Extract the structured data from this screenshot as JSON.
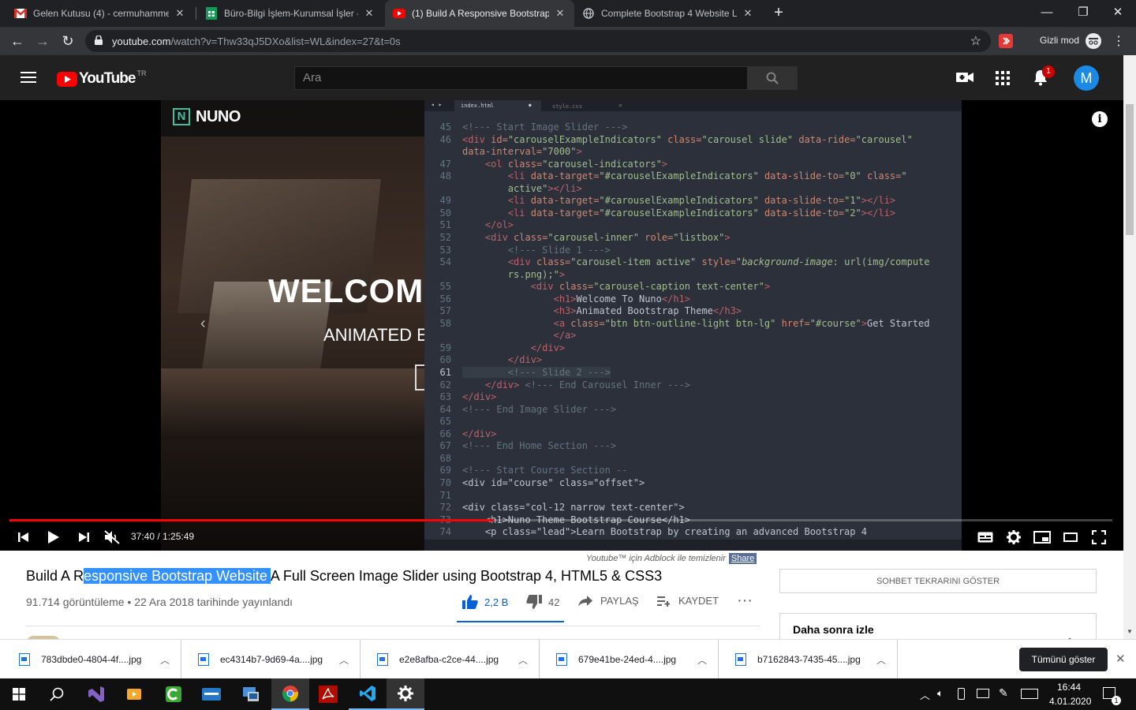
{
  "browser": {
    "tabs": [
      {
        "title": "Gelen Kutusu (4) - cermuhammed",
        "icon": "gmail-icon"
      },
      {
        "title": "Büro-Bilgi İşlem-Kurumsal İşler - ",
        "icon": "sheets-icon"
      },
      {
        "title": "(1) Build A Responsive Bootstrap",
        "icon": "youtube-icon",
        "active": true
      },
      {
        "title": "Complete Bootstrap 4 Website La",
        "icon": "globe-icon"
      }
    ],
    "url_host": "youtube.com",
    "url_rest": "/watch?v=Thw33qJ5DXo&list=WL&index=27&t=0s",
    "incognito_label": "Gizli mod"
  },
  "youtube": {
    "logo_text": "YouTube",
    "region": "TR",
    "search_placeholder": "Ara",
    "notif_count": "1",
    "avatar_letter": "M"
  },
  "video": {
    "brand": "NUNO",
    "overlay_welcome": "WELCOM",
    "overlay_sub": "ANIMATED E",
    "time": "37:40 / 1:25:49",
    "progress": 0.439,
    "editor_tabs": [
      "index.html",
      "style.css"
    ],
    "code_lines": [
      {
        "n": "45",
        "html": "<span class='kc'>&lt;!--- Start Image Slider ---&gt;</span>"
      },
      {
        "n": "46",
        "html": "<span class='kt'>&lt;div</span> <span class='ka'>id=</span><span class='ks'>\"carouselExampleIndicators\"</span> <span class='ka'>class=</span><span class='ks'>\"carousel slide\"</span> <span class='ka'>data-ride=</span><span class='ks'>\"carousel\"</span>"
      },
      {
        "n": "",
        "html": "<span class='ka'>data-interval=</span><span class='ks'>\"7000\"</span><span class='kt'>&gt;</span>"
      },
      {
        "n": "47",
        "html": "    <span class='kt'>&lt;ol</span> <span class='ka'>class=</span><span class='ks'>\"carousel-indicators\"</span><span class='kt'>&gt;</span>"
      },
      {
        "n": "48",
        "html": "        <span class='kt'>&lt;li</span> <span class='ka'>data-target=</span><span class='ks'>\"#carouselExampleIndicators\"</span> <span class='ka'>data-slide-to=</span><span class='ks'>\"0\"</span> <span class='ka'>class=</span><span class='ks'>\"</span>"
      },
      {
        "n": "",
        "html": "        <span class='ks'>active\"</span><span class='kt'>&gt;&lt;/li&gt;</span>"
      },
      {
        "n": "49",
        "html": "        <span class='kt'>&lt;li</span> <span class='ka'>data-target=</span><span class='ks'>\"#carouselExampleIndicators\"</span> <span class='ka'>data-slide-to=</span><span class='ks'>\"1\"</span><span class='kt'>&gt;&lt;/li&gt;</span>"
      },
      {
        "n": "50",
        "html": "        <span class='kt'>&lt;li</span> <span class='ka'>data-target=</span><span class='ks'>\"#carouselExampleIndicators\"</span> <span class='ka'>data-slide-to=</span><span class='ks'>\"2\"</span><span class='kt'>&gt;&lt;/li&gt;</span>"
      },
      {
        "n": "51",
        "html": "    <span class='kt'>&lt;/ol&gt;</span>"
      },
      {
        "n": "52",
        "html": "    <span class='kt'>&lt;div</span> <span class='ka'>class=</span><span class='ks'>\"carousel-inner\"</span> <span class='ka'>role=</span><span class='ks'>\"listbox\"</span><span class='kt'>&gt;</span>"
      },
      {
        "n": "53",
        "html": "        <span class='kc'>&lt;!--- Slide 1 ---&gt;</span>"
      },
      {
        "n": "54",
        "html": "        <span class='kt'>&lt;div</span> <span class='ka'>class=</span><span class='ks'>\"carousel-item active\"</span> <span class='ka'>style=</span><span class='ks'>\"<i>background-image</i>: url(img/compute</span>"
      },
      {
        "n": "",
        "html": "        <span class='ks'>rs.png);\"</span><span class='kt'>&gt;</span>"
      },
      {
        "n": "55",
        "html": "            <span class='kt'>&lt;div</span> <span class='ka'>class=</span><span class='ks'>\"carousel-caption text-center\"</span><span class='kt'>&gt;</span>"
      },
      {
        "n": "56",
        "html": "                <span class='kt'>&lt;h1&gt;</span>Welcome To Nuno<span class='kt'>&lt;/h1&gt;</span>"
      },
      {
        "n": "57",
        "html": "                <span class='kt'>&lt;h3&gt;</span>Animated Bootstrap Theme<span class='kt'>&lt;/h3&gt;</span>"
      },
      {
        "n": "58",
        "html": "                <span class='kt'>&lt;a</span> <span class='ka'>class=</span><span class='ks'>\"btn btn-outline-light btn-lg\"</span> <span class='ka'>href=</span><span class='ks'>\"#course\"</span><span class='kt'>&gt;</span>Get Started"
      },
      {
        "n": "",
        "html": "                <span class='kt'>&lt;/a&gt;</span>"
      },
      {
        "n": "59",
        "html": "            <span class='kt'>&lt;/div&gt;</span>"
      },
      {
        "n": "60",
        "html": "        <span class='kt'>&lt;/div&gt;</span>"
      },
      {
        "n": "61",
        "html": "        <span class='kc'>&lt;!--- Slide 2 ---&gt;</span>"
      },
      {
        "n": "62",
        "html": "    <span class='kt'>&lt;/div&gt;</span> <span class='kc'>&lt;!--- End Carousel Inner ---&gt;</span>"
      },
      {
        "n": "63",
        "html": "<span class='kt'>&lt;/div&gt;</span>"
      },
      {
        "n": "64",
        "html": "<span class='kc'>&lt;!--- End Image Slider ---&gt;</span>"
      },
      {
        "n": "65",
        "html": ""
      },
      {
        "n": "66",
        "html": "<span class='kt'>&lt;/div&gt;</span>"
      },
      {
        "n": "67",
        "html": "<span class='kc'>&lt;!--- End Home Section ---&gt;</span>"
      },
      {
        "n": "68",
        "html": ""
      },
      {
        "n": "69",
        "html": "<span class='kc'>&lt;!--- Start Course Section --</span>"
      },
      {
        "n": "70",
        "html": "<span class='kw'>&lt;div id=\"course\" class=\"offset\"&gt;</span>"
      },
      {
        "n": "71",
        "html": ""
      },
      {
        "n": "72",
        "html": "<span class='kw'>&lt;div class=\"col-12 narrow text-center\"&gt;</span>"
      },
      {
        "n": "73",
        "html": "    <span class='kw'>&lt;h1&gt;Nuno Theme Bootstrap Course&lt;/h1&gt;</span>"
      },
      {
        "n": "74",
        "html": "    <span class='kw'>&lt;p class=\"lead\"&gt;Learn Bootstrap by creating an advanced Bootstrap 4</span>"
      }
    ]
  },
  "below": {
    "title_pre": "Build A R",
    "title_hl": "esponsive Bootstrap Website ",
    "title_post": "A Full Screen Image Slider using Bootstrap 4, HTML5 & CSS3",
    "meta": "91.714 görüntüleme • 22 Ara 2018 tarihinde yayınlandı",
    "likes": "2,2 B",
    "dislikes": "42",
    "share": "PAYLAŞ",
    "save": "KAYDET",
    "adblock_text": "Youtube™ için Adblock ile temizlenir",
    "adblock_share": "Share",
    "chat_replay": "SOHBET TEKRARINI GÖSTER",
    "watch_later": "Daha sonra izle"
  },
  "downloads": {
    "items": [
      "783dbde0-4804-4f....jpg",
      "ec4314b7-9d69-4a....jpg",
      "e2e8afba-c2ce-44....jpg",
      "679e41be-24ed-4....jpg",
      "b7162843-7435-45....jpg"
    ],
    "show_all": "Tümünü göster"
  },
  "taskbar": {
    "time": "16:44",
    "date": "4.01.2020",
    "notif_count": "1"
  }
}
